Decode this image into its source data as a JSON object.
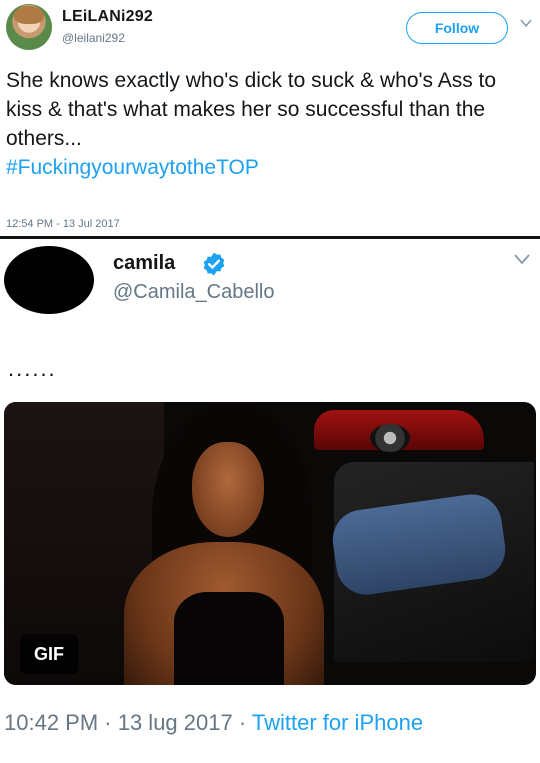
{
  "tweet1": {
    "author_name": "LEiLANi292",
    "author_handle": "@leilani292",
    "follow_label": "Follow",
    "text": "She knows exactly who's dick to suck & who's Ass to kiss & that's what makes her so successful than the others...",
    "hashtag": "#FuckingyourwaytotheTOP",
    "timestamp": "12:54 PM - 13 Jul 2017",
    "icons": {
      "menu": "chevron-down-icon"
    }
  },
  "tweet2": {
    "author_name": "camila",
    "author_handle": "@Camila_Cabello",
    "text": "......",
    "gif_label": "GIF",
    "timestamp": "10:42 PM · 13 lug 2017 · ",
    "source": "Twitter for iPhone",
    "icons": {
      "verified": "verified-badge-icon",
      "menu": "chevron-down-icon"
    }
  },
  "colors": {
    "accent": "#1da1f2",
    "secondary_text": "#657786",
    "primary_text": "#14171a"
  }
}
